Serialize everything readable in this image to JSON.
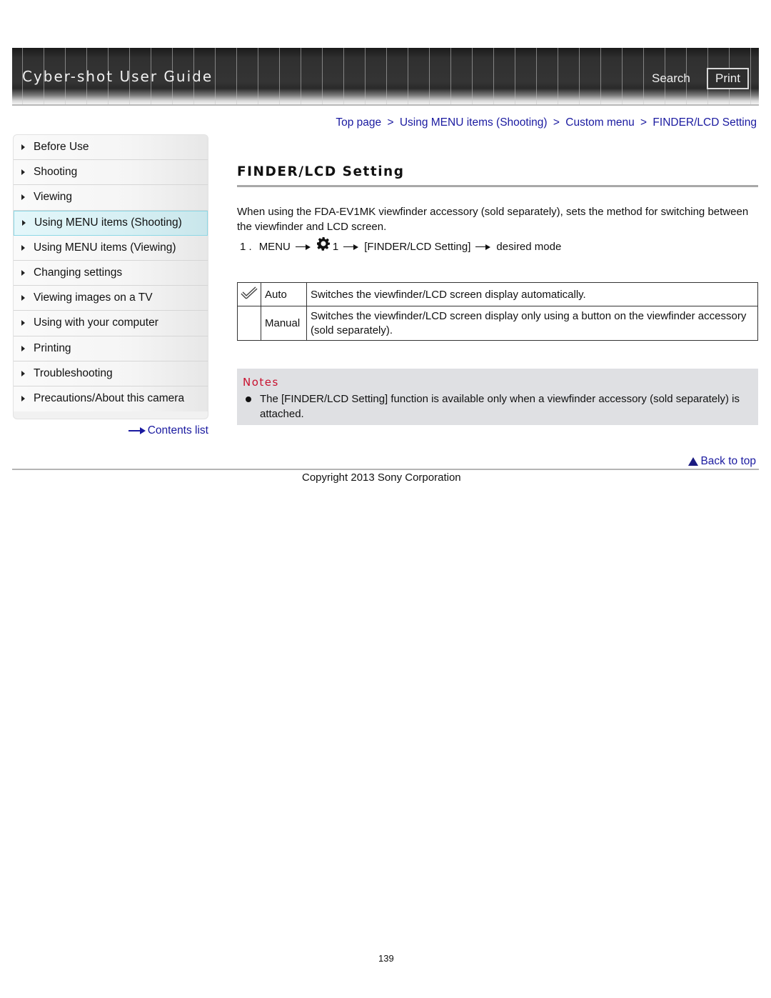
{
  "header": {
    "app_title": "Cyber-shot User Guide",
    "search_label": "Search",
    "print_label": "Print"
  },
  "breadcrumb": [
    {
      "label": "Top page"
    },
    {
      "label": "Using MENU items (Shooting)"
    },
    {
      "label": "Custom menu"
    },
    {
      "label": "FINDER/LCD Setting"
    }
  ],
  "breadcrumb_separator": ">",
  "sidebar": {
    "items": [
      {
        "label": "Before Use",
        "active": false
      },
      {
        "label": "Shooting",
        "active": false
      },
      {
        "label": "Viewing",
        "active": false
      },
      {
        "label": "Using MENU items (Shooting)",
        "active": true
      },
      {
        "label": "Using MENU items (Viewing)",
        "active": false
      },
      {
        "label": "Changing settings",
        "active": false
      },
      {
        "label": "Viewing images on a TV",
        "active": false
      },
      {
        "label": "Using with your computer",
        "active": false
      },
      {
        "label": "Printing",
        "active": false
      },
      {
        "label": "Troubleshooting",
        "active": false
      },
      {
        "label": "Precautions/About this camera",
        "active": false
      }
    ],
    "contents_link": "Contents list"
  },
  "main": {
    "title": "FINDER/LCD Setting",
    "intro": "When using the FDA-EV1MK viewfinder accessory (sold separately), sets the method for switching between the viewfinder and LCD screen.",
    "step": {
      "number": "1 .",
      "menu": "MENU",
      "gear_icon": "gear-icon",
      "tab": "1",
      "setting": "[FINDER/LCD Setting]",
      "target": "desired mode"
    },
    "modes": [
      {
        "icon": "checkmark-icon",
        "name": "Auto",
        "description": "Switches the viewfinder/LCD screen display automatically.",
        "default": true
      },
      {
        "icon": "",
        "name": "Manual",
        "description": "Switches the viewfinder/LCD screen display only using a button on the viewfinder accessory (sold separately).",
        "default": false
      }
    ],
    "notes": {
      "title": "Notes",
      "items": [
        "The [FINDER/LCD Setting] function is available only when a viewfinder accessory (sold separately) is attached."
      ]
    }
  },
  "footer": {
    "back_to_top": "Back to top",
    "copyright": "Copyright 2013 Sony Corporation",
    "page_number": "139"
  },
  "colors": {
    "link": "#1a1aa0",
    "notes_title": "#c8102e",
    "active_sidebar": "#d6eff3",
    "notes_background": "#dfe0e3"
  }
}
